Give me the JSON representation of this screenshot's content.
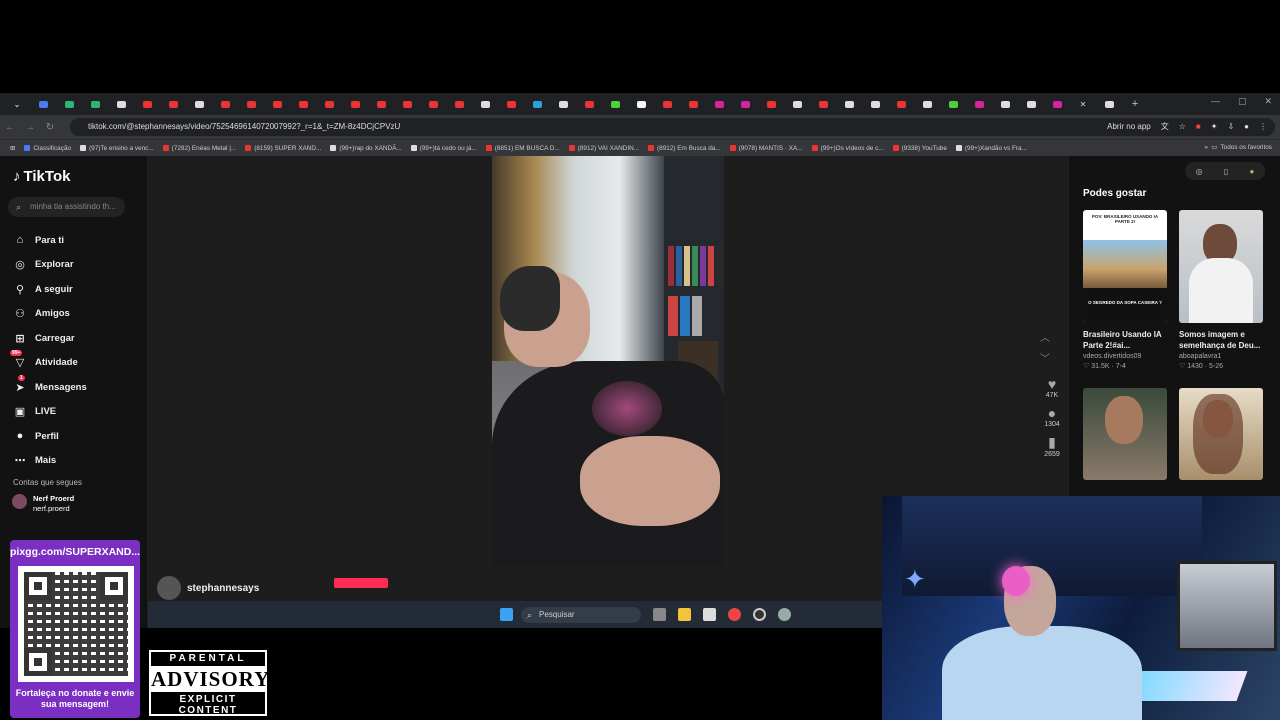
{
  "browser": {
    "url": "tiktok.com/@stephannesays/video/7525469614072007992?_r=1&_t=ZM-8z4DCjCPVzU",
    "open_in_app": "Abrir no app",
    "bookmarks": [
      "Classificação",
      "(97)Te ensino a venc...",
      "(7292) Enéas Metal |...",
      "(8159) SUPER XAND...",
      "(99+)rap do XANDÃ...",
      "(99+)tá cedo ou já...",
      "(8851) EM BUSCA D...",
      "(8912) VAI XANDIN...",
      "(8912) Em Busca da...",
      "(9078) MANTIS · XA...",
      "(99+)Os vídeos de c...",
      "(9338) YouTube",
      "(99+)Xandão vs Fra..."
    ],
    "all_favorites": "Todos os favoritos"
  },
  "tiktok": {
    "logo": "TikTok",
    "search_placeholder": "minha tia assistindo th...",
    "nav": [
      {
        "label": "Para ti",
        "icon": "home-icon"
      },
      {
        "label": "Explorar",
        "icon": "compass-icon"
      },
      {
        "label": "A seguir",
        "icon": "following-icon"
      },
      {
        "label": "Amigos",
        "icon": "friends-icon"
      },
      {
        "label": "Carregar",
        "icon": "upload-icon"
      },
      {
        "label": "Atividade",
        "icon": "activity-icon",
        "badge": "99+"
      },
      {
        "label": "Mensagens",
        "icon": "messages-icon",
        "badge": "1"
      },
      {
        "label": "LIVE",
        "icon": "live-icon"
      },
      {
        "label": "Perfil",
        "icon": "profile-icon"
      },
      {
        "label": "Mais",
        "icon": "more-icon"
      }
    ],
    "following_title": "Contas que segues",
    "following": [
      {
        "name": "Nerf Proerd",
        "handle": "nerf.proerd"
      }
    ],
    "video": {
      "likes": "47K",
      "comments": "1304",
      "saves": "2659",
      "author": "stephannesays"
    },
    "suggest_title": "Podes gostar",
    "suggestions": [
      {
        "title": "Brasileiro Usando IA Parte 2!#ai...",
        "user": "vdeos.divertidos09",
        "likes": "31.5K",
        "date": "7-4",
        "thumb_top": "POV: BRASILEIRO USANDO IA PARTE 2!",
        "thumb_bottom": "O SEGREDO DA SOPA CASEIRA ?"
      },
      {
        "title": "Somos imagem e semelhança de Deu...",
        "user": "aboapalavra1",
        "likes": "1430",
        "date": "5-26"
      }
    ]
  },
  "taskbar": {
    "search": "Pesquisar"
  },
  "overlay": {
    "pix": "pixgg.com/SUPERXAND...",
    "donate": "Fortaleça no donate e envie sua mensagem!",
    "advisory_1": "PARENTAL",
    "advisory_2": "ADVISORY",
    "advisory_3": "EXPLICIT CONTENT"
  }
}
